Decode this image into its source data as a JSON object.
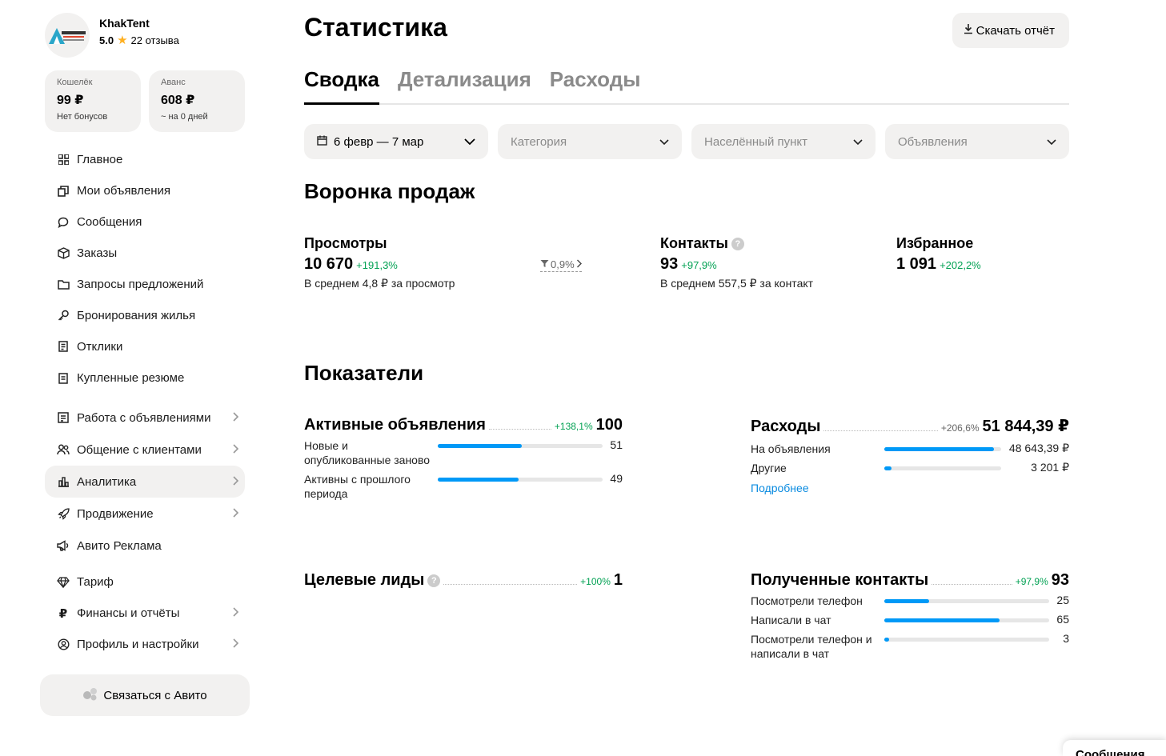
{
  "profile": {
    "name": "KhakTent",
    "rating": "5.0",
    "reviews": "22 отзыва"
  },
  "wallets": [
    {
      "label": "Кошелёк",
      "value": "99 ₽",
      "sub": "Нет бонусов"
    },
    {
      "label": "Аванс",
      "value": "608 ₽",
      "sub": "~ на 0 дней"
    }
  ],
  "nav_group1": [
    {
      "label": "Главное",
      "icon": "grid-icon"
    },
    {
      "label": "Мои объявления",
      "icon": "copy-icon"
    },
    {
      "label": "Сообщения",
      "icon": "chat-icon"
    },
    {
      "label": "Заказы",
      "icon": "box-icon"
    },
    {
      "label": "Запросы предложений",
      "icon": "folder-icon"
    },
    {
      "label": "Бронирования жилья",
      "icon": "key-icon"
    },
    {
      "label": "Отклики",
      "icon": "document-icon"
    },
    {
      "label": "Купленные резюме",
      "icon": "resume-icon"
    }
  ],
  "nav_group2": [
    {
      "label": "Работа с объявлениями",
      "icon": "list-icon",
      "chevron": true
    },
    {
      "label": "Общение с клиентами",
      "icon": "users-icon",
      "chevron": true
    },
    {
      "label": "Аналитика",
      "icon": "chart-icon",
      "chevron": true,
      "active": true
    },
    {
      "label": "Продвижение",
      "icon": "rocket-icon",
      "chevron": true
    },
    {
      "label": "Авито Реклама",
      "icon": "megaphone-icon",
      "chevron": false
    }
  ],
  "nav_group3": [
    {
      "label": "Тариф",
      "icon": "diamond-icon",
      "chevron": false
    },
    {
      "label": "Финансы и отчёты",
      "icon": "ruble-icon",
      "chevron": true
    },
    {
      "label": "Профиль и настройки",
      "icon": "profile-icon",
      "chevron": true
    }
  ],
  "contact_button": "Связаться с Авито",
  "page_title": "Статистика",
  "download_button": "Скачать отчёт",
  "tabs": [
    {
      "label": "Сводка",
      "active": true
    },
    {
      "label": "Детализация",
      "active": false
    },
    {
      "label": "Расходы",
      "active": false
    }
  ],
  "filters": {
    "date": "6 февр — 7 мар",
    "category": "Категория",
    "location": "Населённый пункт",
    "ads": "Объявления"
  },
  "funnel": {
    "title": "Воронка продаж",
    "views": {
      "label": "Просмотры",
      "value": "10 670",
      "delta": "+191,3%",
      "sub": "В среднем 4,8 ₽ за просмотр"
    },
    "conversion": "0,9%",
    "contacts": {
      "label": "Контакты",
      "value": "93",
      "delta": "+97,9%",
      "sub": "В среднем 557,5 ₽ за контакт"
    },
    "favorites": {
      "label": "Избранное",
      "value": "1 091",
      "delta": "+202,2%"
    }
  },
  "indicators": {
    "title": "Показатели",
    "active_ads": {
      "title": "Активные объявления",
      "delta": "+138,1%",
      "value": "100",
      "rows": [
        {
          "label": "Новые и опубликованные заново",
          "value": "51",
          "fill": 0.51
        },
        {
          "label": "Активны с прошлого периода",
          "value": "49",
          "fill": 0.49
        }
      ]
    },
    "expenses": {
      "title": "Расходы",
      "delta": "+206,6%",
      "value": "51 844,39 ₽",
      "rows": [
        {
          "label": "На объявления",
          "value": "48 643,39 ₽",
          "fill": 0.94
        },
        {
          "label": "Другие",
          "value": "3 201 ₽",
          "fill": 0.06
        }
      ],
      "link": "Подробнее"
    },
    "target_leads": {
      "title": "Целевые лиды",
      "delta": "+100%",
      "value": "1"
    },
    "received_contacts": {
      "title": "Полученные контакты",
      "delta": "+97,9%",
      "value": "93",
      "rows": [
        {
          "label": "Посмотрели телефон",
          "value": "25",
          "fill": 0.27
        },
        {
          "label": "Написали в чат",
          "value": "65",
          "fill": 0.7
        },
        {
          "label": "Посмотрели телефон и написали в чат",
          "value": "3",
          "fill": 0.03
        }
      ]
    }
  },
  "messages_tab": "Сообщения",
  "colors": {
    "accent": "#0099f7",
    "positive": "#02a153",
    "link": "#0a8be0",
    "surface": "#f2f1f0"
  }
}
